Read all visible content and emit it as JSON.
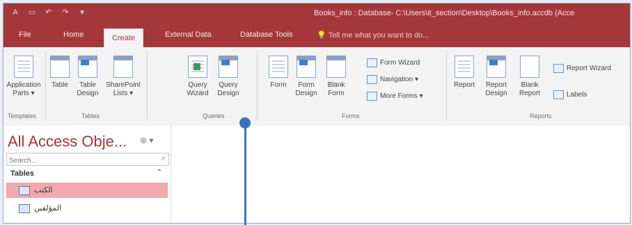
{
  "window": {
    "title": "Books_info : Database- C:\\Users\\it_section\\Desktop\\Books_info.accdb (Acce"
  },
  "quick_access": {
    "icons": [
      "access-logo-icon",
      "save-icon",
      "undo-icon",
      "redo-icon",
      "customize-icon"
    ]
  },
  "tabs": [
    {
      "label": "File"
    },
    {
      "label": "Home"
    },
    {
      "label": "Create"
    },
    {
      "label": "External Data"
    },
    {
      "label": "Database Tools"
    }
  ],
  "active_tab": "Create",
  "tell_me": {
    "placeholder": "Tell me what you want to do..."
  },
  "ribbon": {
    "templates": {
      "application_parts": "Application Parts ▾",
      "group_label": "Templates"
    },
    "tables": {
      "table": "Table",
      "table_design": "Table Design",
      "sharepoint_lists": "SharePoint Lists ▾",
      "group_label": "Tables"
    },
    "queries": {
      "query_wizard": "Query Wizard",
      "query_design": "Query Design",
      "group_label": "Queries"
    },
    "forms": {
      "form": "Form",
      "form_design": "Form Design",
      "blank_form": "Blank Form",
      "form_wizard": "Form Wizard",
      "navigation": "Navigation ▾",
      "more_forms": "More Forms ▾",
      "group_label": "Forms"
    },
    "reports": {
      "report": "Report",
      "report_design": "Report Design",
      "blank_report": "Blank Report",
      "report_wizard": "Report Wizard",
      "labels": "Labels",
      "group_label": "Reports"
    }
  },
  "nav_pane": {
    "title": "All Access Obje...",
    "search_placeholder": "Search...",
    "section": "Tables",
    "items": [
      {
        "label": "الكتب",
        "selected": true
      },
      {
        "label": "المؤلفين",
        "selected": false
      }
    ]
  },
  "colors": {
    "accent": "#a4373a",
    "selected_item": "#f2a9ad",
    "annotation": "#3a73bd"
  }
}
